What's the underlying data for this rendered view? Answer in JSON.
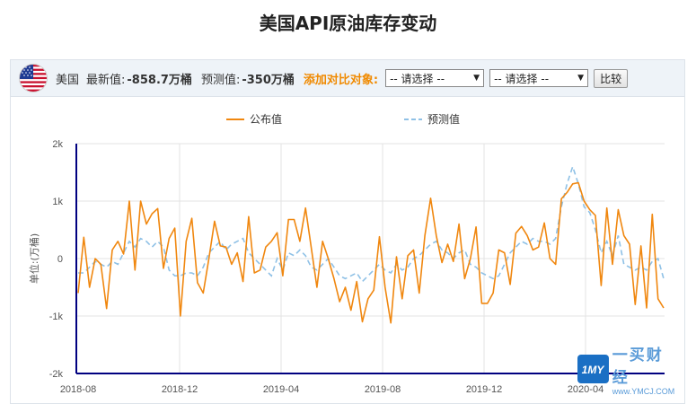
{
  "page": {
    "title": "美国API原油库存变动"
  },
  "toolbar": {
    "country": "美国",
    "latest_label": "最新值:",
    "latest_value": "-858.7万桶",
    "forecast_label": "预测值:",
    "forecast_value": "-350万桶",
    "add_compare_label": "添加对比对象:",
    "select1_value": "-- 请选择 --",
    "select2_value": "-- 请选择 --",
    "compare_button": "比较"
  },
  "watermark": {
    "brand": "一买财经",
    "url": "www.YMCJ.COM",
    "logo_text": "1MY"
  },
  "colors": {
    "actual": "#f0870f",
    "forecast": "#8fc1e6",
    "axis": "#000080",
    "grid": "#e3e3e3",
    "add_label": "#f08a00"
  },
  "chart_data": {
    "type": "line",
    "ylabel": "单位:(万桶)",
    "ylim": [
      -2000,
      2000
    ],
    "y_ticks": [
      2000,
      1000,
      0,
      -1000,
      -2000
    ],
    "y_tick_labels": [
      "2k",
      "1k",
      "0",
      "-1k",
      "-2k"
    ],
    "x_ticks": [
      "2018-08",
      "2018-12",
      "2019-04",
      "2019-08",
      "2019-12",
      "2020-04"
    ],
    "grid": true,
    "legend_position": "top",
    "series": [
      {
        "name": "公布值",
        "style": "solid",
        "values": [
          -600,
          370,
          -500,
          0,
          -100,
          -870,
          150,
          300,
          80,
          1000,
          -200,
          1000,
          600,
          780,
          870,
          -170,
          350,
          530,
          -1000,
          300,
          700,
          -420,
          -600,
          0,
          650,
          220,
          200,
          -100,
          100,
          -400,
          730,
          -250,
          -200,
          200,
          300,
          450,
          -300,
          680,
          680,
          300,
          880,
          200,
          -500,
          300,
          0,
          -350,
          -750,
          -500,
          -900,
          -400,
          -1100,
          -700,
          -550,
          380,
          -500,
          -1120,
          30,
          -700,
          50,
          150,
          -600,
          400,
          1050,
          400,
          -70,
          250,
          -50,
          600,
          -350,
          0,
          550,
          -780,
          -780,
          -600,
          150,
          100,
          -450,
          440,
          560,
          400,
          150,
          200,
          620,
          0,
          -100,
          1040,
          1150,
          1300,
          1320,
          1000,
          850,
          750,
          -470,
          880,
          -100,
          850,
          400,
          250,
          -800,
          220,
          -860,
          770,
          -700,
          -858.7
        ]
      },
      {
        "name": "预测值",
        "style": "dashed",
        "values": [
          -250,
          -250,
          -150,
          -50,
          -100,
          -150,
          -50,
          -100,
          100,
          300,
          200,
          350,
          300,
          200,
          300,
          200,
          -200,
          -300,
          -300,
          -250,
          -250,
          -300,
          -150,
          100,
          200,
          300,
          150,
          250,
          300,
          350,
          100,
          0,
          -100,
          -200,
          -300,
          0,
          -200,
          100,
          50,
          150,
          50,
          -150,
          -200,
          -100,
          0,
          -150,
          -300,
          -350,
          -300,
          -250,
          -400,
          -300,
          -200,
          -100,
          -200,
          -250,
          -100,
          -200,
          -150,
          0,
          50,
          150,
          250,
          300,
          150,
          100,
          0,
          100,
          150,
          -100,
          -150,
          -250,
          -300,
          -350,
          -300,
          -100,
          100,
          200,
          300,
          250,
          350,
          300,
          300,
          250,
          350,
          900,
          1300,
          1600,
          1300,
          900,
          800,
          500,
          100,
          300,
          50,
          400,
          -100,
          -150,
          -200,
          -150,
          -200,
          -50,
          0,
          -350
        ]
      }
    ]
  }
}
